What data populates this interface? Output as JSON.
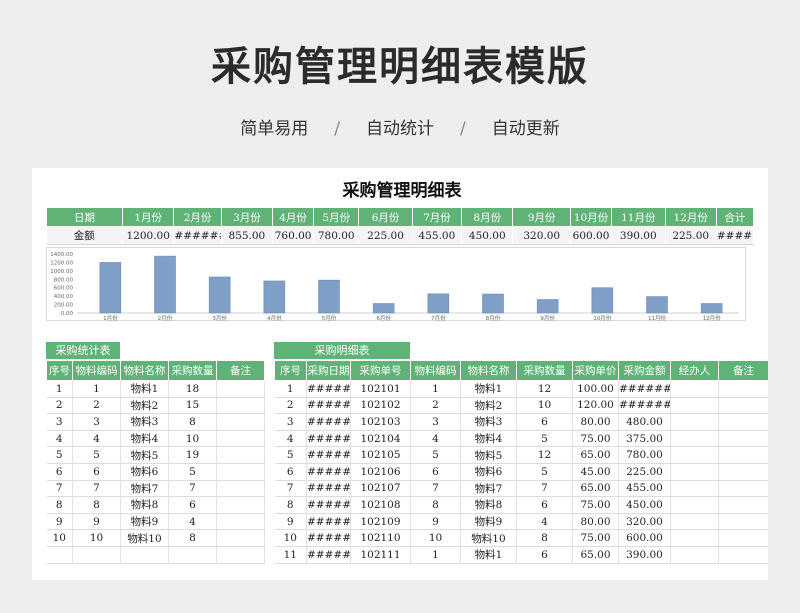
{
  "hero": {
    "title": "采购管理明细表模版",
    "features": [
      "简单易用",
      "自动统计",
      "自动更新"
    ],
    "separator": "/"
  },
  "sheet": {
    "title": "采购管理明细表",
    "monthly": {
      "headers": [
        "日期",
        "1月份",
        "2月份",
        "3月份",
        "4月份",
        "5月份",
        "6月份",
        "7月份",
        "8月份",
        "9月份",
        "10月份",
        "11月份",
        "12月份",
        "合计"
      ],
      "row_label": "金额",
      "values": [
        "1200.00",
        "#######",
        "855.00",
        "760.00",
        "780.00",
        "225.00",
        "455.00",
        "450.00",
        "320.00",
        "600.00",
        "390.00",
        "225.00",
        "######"
      ]
    },
    "stats": {
      "tab_label": "采购统计表",
      "headers": [
        "序号",
        "物料编码",
        "物料名称",
        "采购数量",
        "备注"
      ],
      "rows": [
        [
          "1",
          "1",
          "物料1",
          "18",
          ""
        ],
        [
          "2",
          "2",
          "物料2",
          "15",
          ""
        ],
        [
          "3",
          "3",
          "物料3",
          "8",
          ""
        ],
        [
          "4",
          "4",
          "物料4",
          "10",
          ""
        ],
        [
          "5",
          "5",
          "物料5",
          "19",
          ""
        ],
        [
          "6",
          "6",
          "物料6",
          "5",
          ""
        ],
        [
          "7",
          "7",
          "物料7",
          "7",
          ""
        ],
        [
          "8",
          "8",
          "物料8",
          "6",
          ""
        ],
        [
          "9",
          "9",
          "物料9",
          "4",
          ""
        ],
        [
          "10",
          "10",
          "物料10",
          "8",
          ""
        ],
        [
          "",
          "",
          "",
          "",
          ""
        ]
      ]
    },
    "details": {
      "tab_label": "采购明细表",
      "headers": [
        "序号",
        "采购日期",
        "采购单号",
        "物料编码",
        "物料名称",
        "采购数量",
        "采购单价",
        "采购金额",
        "经办人",
        "备注"
      ],
      "rows": [
        [
          "1",
          "######",
          "102101",
          "1",
          "物料1",
          "12",
          "100.00",
          "########",
          "",
          ""
        ],
        [
          "2",
          "######",
          "102102",
          "2",
          "物料2",
          "10",
          "120.00",
          "########",
          "",
          ""
        ],
        [
          "3",
          "######",
          "102103",
          "3",
          "物料3",
          "6",
          "80.00",
          "480.00",
          "",
          ""
        ],
        [
          "4",
          "######",
          "102104",
          "4",
          "物料4",
          "5",
          "75.00",
          "375.00",
          "",
          ""
        ],
        [
          "5",
          "######",
          "102105",
          "5",
          "物料5",
          "12",
          "65.00",
          "780.00",
          "",
          ""
        ],
        [
          "6",
          "######",
          "102106",
          "6",
          "物料6",
          "5",
          "45.00",
          "225.00",
          "",
          ""
        ],
        [
          "7",
          "######",
          "102107",
          "7",
          "物料7",
          "7",
          "65.00",
          "455.00",
          "",
          ""
        ],
        [
          "8",
          "######",
          "102108",
          "8",
          "物料8",
          "6",
          "75.00",
          "450.00",
          "",
          ""
        ],
        [
          "9",
          "######",
          "102109",
          "9",
          "物料9",
          "4",
          "80.00",
          "320.00",
          "",
          ""
        ],
        [
          "10",
          "######",
          "102110",
          "10",
          "物料10",
          "8",
          "75.00",
          "600.00",
          "",
          ""
        ],
        [
          "11",
          "######",
          "102111",
          "1",
          "物料1",
          "6",
          "65.00",
          "390.00",
          "",
          ""
        ]
      ]
    }
  },
  "chart_data": {
    "type": "bar",
    "categories": [
      "1月份",
      "2月份",
      "3月份",
      "4月份",
      "5月份",
      "6月份",
      "7月份",
      "8月份",
      "9月份",
      "10月份",
      "11月份",
      "12月份"
    ],
    "values": [
      1200,
      1350,
      855,
      760,
      780,
      225,
      455,
      450,
      320,
      600,
      390,
      225
    ],
    "yticks": [
      "1400.00",
      "1200.00",
      "1000.00",
      "800.00",
      "600.00",
      "400.00",
      "200.00",
      "0.00"
    ],
    "ylim": [
      0,
      1400
    ],
    "grid": false,
    "bar_color": "#7f9fc7"
  },
  "colors": {
    "accent": "#5fb377",
    "background": "#eeeeee"
  }
}
